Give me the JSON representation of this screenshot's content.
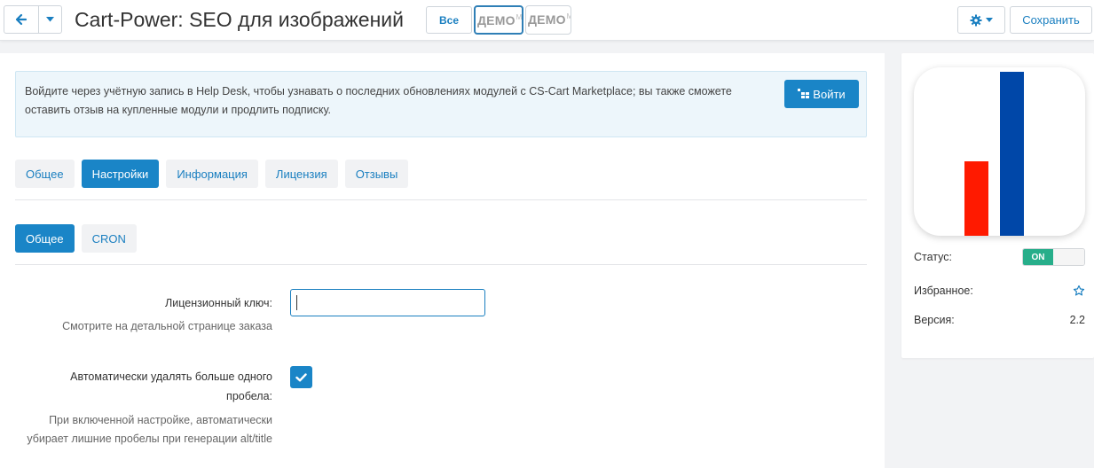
{
  "header": {
    "title": "Cart-Power: SEO для изображений",
    "all_label": "Все",
    "demo_badges": [
      {
        "main": "ДЕМО",
        "sub": "MA"
      },
      {
        "main": "ДЕМО",
        "sub": "MA"
      }
    ],
    "save_label": "Сохранить"
  },
  "alert": {
    "text": "Войдите через учётную запись в Help Desk, чтобы узнавать о последних обновлениях модулей с CS-Cart Marketplace; вы также сможете оставить отзыв на купленные модули и продлить подписку.",
    "login_label": "Войти"
  },
  "tabs": [
    {
      "label": "Общее",
      "active": false
    },
    {
      "label": "Настройки",
      "active": true
    },
    {
      "label": "Информация",
      "active": false
    },
    {
      "label": "Лицензия",
      "active": false
    },
    {
      "label": "Отзывы",
      "active": false
    }
  ],
  "subtabs": [
    {
      "label": "Общее",
      "active": true
    },
    {
      "label": "CRON",
      "active": false
    }
  ],
  "settings": {
    "license_key": {
      "label": "Лицензионный ключ:",
      "help": "Смотрите на детальной странице заказа",
      "value": ""
    },
    "auto_spaces": {
      "label": "Автоматически удалять больше одного пробела:",
      "help": "При включенной настройке, автоматически убирает лишние пробелы при генерации alt/title",
      "checked": true
    }
  },
  "side": {
    "status_label": "Статус:",
    "status_value": "ON",
    "favorite_label": "Избранное:",
    "version_label": "Версия:",
    "version_value": "2.2"
  },
  "colors": {
    "accent": "#1a85c7",
    "status_on": "#27ae8a",
    "logo_red": "#ff1a00",
    "logo_blue": "#0047a8"
  }
}
